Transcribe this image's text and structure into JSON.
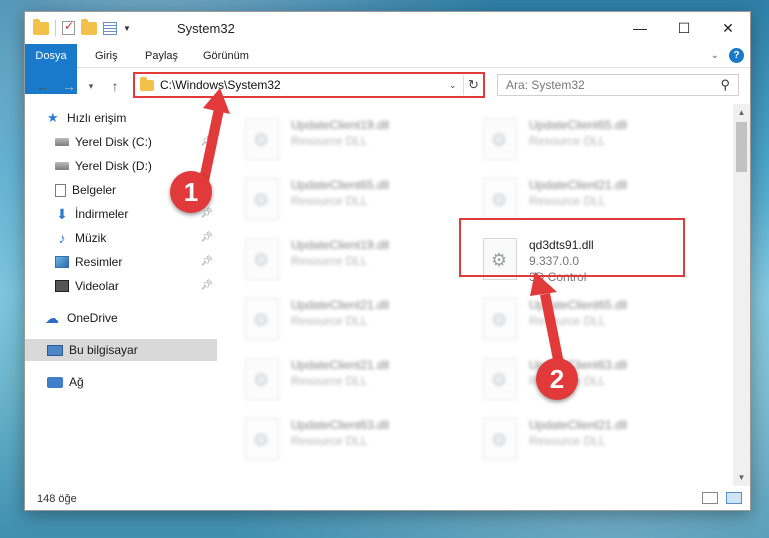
{
  "window": {
    "title": "System32",
    "controls": {
      "minimize": "—",
      "maximize": "☐",
      "close": "✕"
    }
  },
  "ribbon": {
    "tabs": [
      "Dosya",
      "Giriş",
      "Paylaş",
      "Görünüm"
    ],
    "help": "?"
  },
  "navigation": {
    "back": "←",
    "forward": "→",
    "recent": "▾",
    "up": "↑",
    "address": "C:\\Windows\\System32",
    "address_caret": "⌄",
    "refresh": "↻",
    "search_placeholder": "Ara: System32",
    "search_icon": "⚲"
  },
  "sidebar": {
    "items": [
      {
        "label": "Hızlı erişim",
        "icon": "star-icon"
      },
      {
        "label": "Yerel Disk (C:)",
        "icon": "drive-icon",
        "pinned": true
      },
      {
        "label": "Yerel Disk (D:)",
        "icon": "drive-icon",
        "pinned": true
      },
      {
        "label": "Belgeler",
        "icon": "documents-icon",
        "pinned": true
      },
      {
        "label": "İndirmeler",
        "icon": "download-icon",
        "pinned": true
      },
      {
        "label": "Müzik",
        "icon": "music-icon",
        "pinned": true
      },
      {
        "label": "Resimler",
        "icon": "pictures-icon",
        "pinned": true
      },
      {
        "label": "Videolar",
        "icon": "videos-icon",
        "pinned": true
      },
      {
        "label": "OneDrive",
        "icon": "cloud-icon"
      },
      {
        "label": "Bu bilgisayar",
        "icon": "computer-icon",
        "selected": true
      },
      {
        "label": "Ağ",
        "icon": "network-icon"
      }
    ]
  },
  "files": {
    "left": [
      {
        "name": "UpdateClient19.dll",
        "type": "Resource DLL"
      },
      {
        "name": "UpdateClient65.dll",
        "type": "Resource DLL"
      },
      {
        "name": "UpdateClient19.dll",
        "type": "Resource DLL"
      },
      {
        "name": "UpdateClient21.dll",
        "type": "Resource DLL"
      },
      {
        "name": "UpdateClient21.dll",
        "type": "Resource DLL"
      },
      {
        "name": "UpdateClient63.dll",
        "type": "Resource DLL"
      }
    ],
    "right_top": [
      {
        "name": "UpdateClient65.dll",
        "type": "Resource DLL"
      },
      {
        "name": "UpdateClient21.dll",
        "type": "Resource DLL"
      }
    ],
    "highlighted": {
      "name": "qd3dts91.dll",
      "version": "9.337.0.0",
      "type": "3D Control"
    },
    "right_bottom": [
      {
        "name": "UpdateClient65.dll",
        "type": "Resource DLL"
      },
      {
        "name": "UpdateClient63.dll",
        "type": "Resource DLL"
      },
      {
        "name": "UpdateClient21.dll",
        "type": "Resource DLL"
      }
    ]
  },
  "status": {
    "count": "148 öğe"
  },
  "annotations": {
    "badge1": "1",
    "badge2": "2",
    "color": "#e23a3a"
  }
}
